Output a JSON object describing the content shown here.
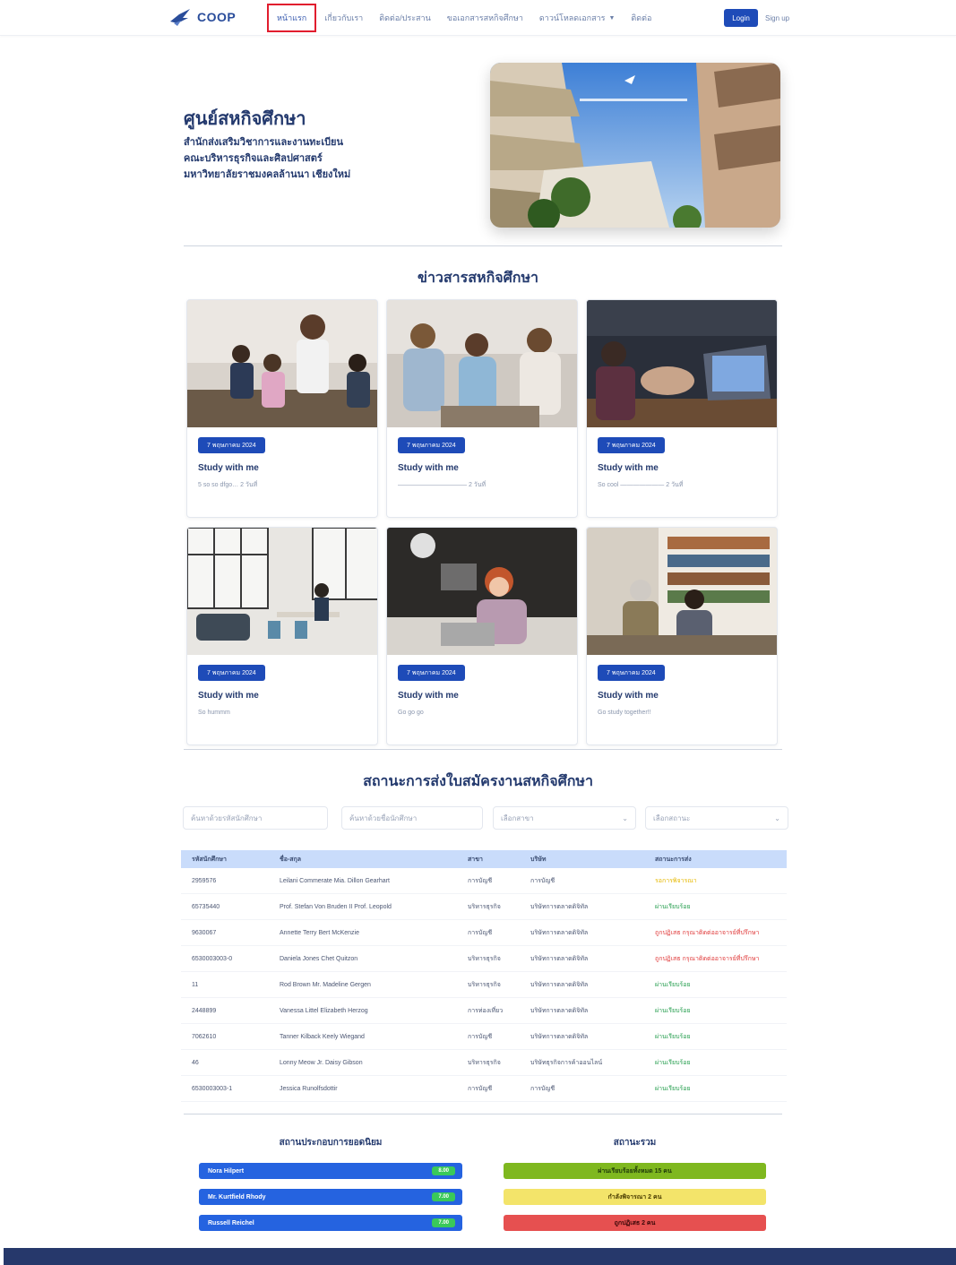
{
  "nav": {
    "logo_text": "COOP",
    "links": [
      "หน้าแรก",
      "เกี่ยวกับเรา",
      "ติดต่อ/ประสาน",
      "ขอเอกสารสหกิจศึกษา",
      "ดาวน์โหลดเอกสาร",
      "ติดต่อ"
    ],
    "login": "Login",
    "signup": "Sign up"
  },
  "hero": {
    "title": "ศูนย์สหกิจศึกษา",
    "line1": "สำนักส่งเสริมวิชาการและงานทะเบียน",
    "line2": "คณะบริหารธุรกิจและศิลปศาสตร์",
    "line3": "มหาวิทยาลัยราชมงคลล้านนา เชียงใหม่"
  },
  "news": {
    "title": "ข่าวสารสหกิจศึกษา",
    "cards": [
      {
        "date": "7 พฤษภาคม 2024",
        "title": "Study with me",
        "desc": "5 so so dfgo…  2 วันที่"
      },
      {
        "date": "7 พฤษภาคม 2024",
        "title": "Study with me",
        "desc": "——————————— 2 วันที่"
      },
      {
        "date": "7 พฤษภาคม 2024",
        "title": "Study with me",
        "desc": "So cool ——————— 2 วันที่"
      },
      {
        "date": "7 พฤษภาคม 2024",
        "title": "Study with me",
        "desc": "So hummm"
      },
      {
        "date": "7 พฤษภาคม 2024",
        "title": "Study with me",
        "desc": "Go go go"
      },
      {
        "date": "7 พฤษภาคม 2024",
        "title": "Study with me",
        "desc": "Go study together!!"
      }
    ]
  },
  "status": {
    "title": "สถานะการส่งใบสมัครงานสหกิจศึกษา",
    "filters": {
      "student_id": "ค้นหาด้วยรหัสนักศึกษา",
      "name": "ค้นหาด้วยชื่อนักศึกษา",
      "major": "เลือกสาขา",
      "status": "เลือกสถานะ"
    },
    "headers": [
      "รหัสนักศึกษา",
      "ชื่อ-สกุล",
      "สาขา",
      "บริษัท",
      "สถานะการส่ง"
    ],
    "rows": [
      {
        "id": "2959576",
        "name": "Leilani Commerate Mia. Dillon Gearhart",
        "major": "การบัญชี",
        "company": "การบัญชี",
        "status": "รอการพิจารณา",
        "tone": "yellow"
      },
      {
        "id": "65735440",
        "name": "Prof. Stefan Von Bruden II Prof. Leopold",
        "major": "บริหารธุรกิจ",
        "company": "บริษัทการตลาดดิจิทัล",
        "status": "ผ่านเรียบร้อย",
        "tone": "green"
      },
      {
        "id": "9630067",
        "name": "Annette Terry Bert McKenzie",
        "major": "การบัญชี",
        "company": "บริษัทการตลาดดิจิทัล",
        "status": "ถูกปฏิเสธ กรุณาติดต่ออาจารย์ที่ปรึกษา",
        "tone": "red"
      },
      {
        "id": "6530003003-0",
        "name": "Daniela Jones Chet Quitzon",
        "major": "บริหารธุรกิจ",
        "company": "บริษัทการตลาดดิจิทัล",
        "status": "ถูกปฏิเสธ กรุณาติดต่ออาจารย์ที่ปรึกษา",
        "tone": "red"
      },
      {
        "id": "11",
        "name": "Rod Brown Mr. Madeline Gergen",
        "major": "บริหารธุรกิจ",
        "company": "บริษัทการตลาดดิจิทัล",
        "status": "ผ่านเรียบร้อย",
        "tone": "green"
      },
      {
        "id": "2448899",
        "name": "Vanessa Littel Elizabeth Herzog",
        "major": "การท่องเที่ยว",
        "company": "บริษัทการตลาดดิจิทัล",
        "status": "ผ่านเรียบร้อย",
        "tone": "green"
      },
      {
        "id": "7062610",
        "name": "Tanner Kilback Keely Wiegand",
        "major": "การบัญชี",
        "company": "บริษัทการตลาดดิจิทัล",
        "status": "ผ่านเรียบร้อย",
        "tone": "green"
      },
      {
        "id": "46",
        "name": "Lonny Meow Jr. Daisy Gibson",
        "major": "บริหารธุรกิจ",
        "company": "บริษัทธุรกิจการค้าออนไลน์",
        "status": "ผ่านเรียบร้อย",
        "tone": "green"
      },
      {
        "id": "6530003003-1",
        "name": "Jessica Runolfsdottir",
        "major": "การบัญชี",
        "company": "การบัญชี",
        "status": "ผ่านเรียบร้อย",
        "tone": "green"
      }
    ]
  },
  "evaluation": {
    "title": "สถานประกอบการยอดนิยม",
    "items": [
      {
        "name": "Nora Hilpert",
        "badge": "8.00"
      },
      {
        "name": "Mr. Kurtfield Rhody",
        "badge": "7.00"
      },
      {
        "name": "Russell Reichel",
        "badge": "7.00"
      }
    ]
  },
  "summary": {
    "title": "สถานะรวม",
    "items": [
      {
        "label": "ผ่านเรียบร้อยทั้งหมด 15 คน",
        "color": "#7fb81f",
        "text_color": "#1f3a0a"
      },
      {
        "label": "กำลังพิจารณา 2 คน",
        "color": "#f3e46a",
        "text_color": "#4a3c00"
      },
      {
        "label": "ถูกปฏิเสธ 2 คน",
        "color": "#e65050",
        "text_color": "#3a0808"
      }
    ]
  }
}
